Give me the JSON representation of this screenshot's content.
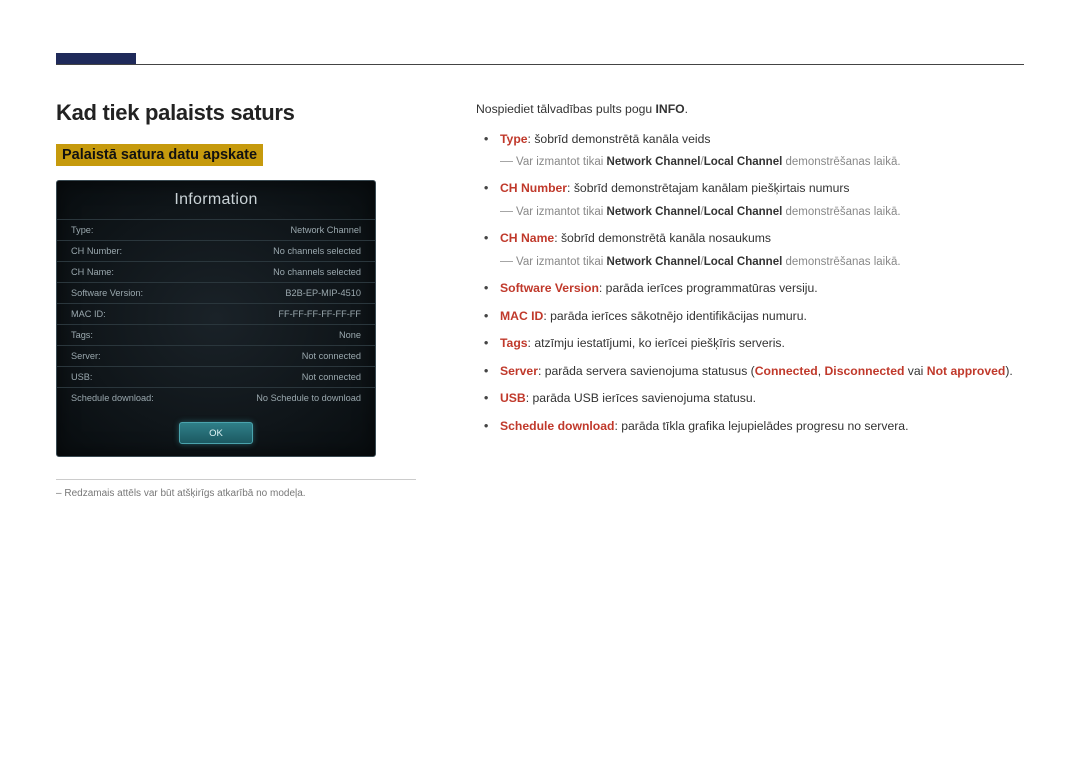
{
  "heading": "Kad tiek palaists saturs",
  "subheading": "Palaistā satura datu apskate",
  "panel": {
    "title": "Information",
    "rows": [
      {
        "label": "Type:",
        "value": "Network Channel"
      },
      {
        "label": "CH Number:",
        "value": "No channels selected"
      },
      {
        "label": "CH Name:",
        "value": "No channels selected"
      },
      {
        "label": "Software Version:",
        "value": "B2B-EP-MIP-4510"
      },
      {
        "label": "MAC ID:",
        "value": "FF-FF-FF-FF-FF-FF"
      },
      {
        "label": "Tags:",
        "value": "None"
      },
      {
        "label": "Server:",
        "value": "Not connected"
      },
      {
        "label": "USB:",
        "value": "Not connected"
      },
      {
        "label": "Schedule download:",
        "value": "No Schedule to download"
      }
    ],
    "ok": "OK"
  },
  "image_caption": "Redzamais attēls var būt atšķirīgs atkarībā no modeļa.",
  "intro_pre": "Nospiediet tālvadības pults pogu ",
  "intro_bold": "INFO",
  "intro_post": ".",
  "note_pre": "Var izmantot tikai ",
  "note_b1": "Network Channel",
  "note_slash": "/",
  "note_b2": "Local Channel",
  "note_post": " demonstrēšanas laikā.",
  "items": {
    "type": {
      "term": "Type",
      "text": ": šobrīd demonstrētā kanāla veids"
    },
    "chnum": {
      "term": "CH Number",
      "text": ": šobrīd demonstrētajam kanālam piešķirtais numurs"
    },
    "chname": {
      "term": "CH Name",
      "text": ": šobrīd demonstrētā kanāla nosaukums"
    },
    "swver": {
      "term": "Software Version",
      "text": ": parāda ierīces programmatūras versiju."
    },
    "macid": {
      "term": "MAC ID",
      "text": ": parāda ierīces sākotnējo identifikācijas numuru."
    },
    "tags": {
      "term": "Tags",
      "text": ": atzīmju iestatījumi, ko ierīcei piešķīris serveris."
    },
    "server": {
      "term": "Server",
      "pre": ": parāda servera savienojuma statusus (",
      "s1": "Connected",
      "c1": ", ",
      "s2": "Disconnected",
      "c2": " vai ",
      "s3": "Not approved",
      "post": ")."
    },
    "usb": {
      "term": "USB",
      "text": ": parāda USB ierīces savienojuma statusu."
    },
    "sched": {
      "term": "Schedule download",
      "text": ": parāda tīkla grafika lejupielādes progresu no servera."
    }
  }
}
